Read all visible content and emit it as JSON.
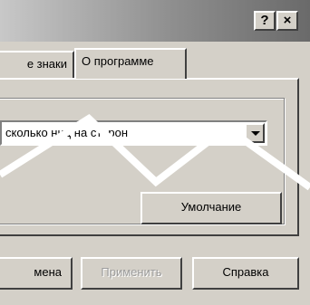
{
  "window": {
    "help_glyph": "?",
    "close_glyph": "×"
  },
  "tabs": [
    {
      "label": "е знаки"
    },
    {
      "label": "О программе"
    }
  ],
  "combo": {
    "visible_text": "сколько      ниц на сторон"
  },
  "buttons": {
    "defaults": "Умолчание",
    "cancel": "мена",
    "apply": "Применить",
    "help": "Справка"
  },
  "colors": {
    "face": "#d4d0c8",
    "tear": "#ffffff"
  }
}
